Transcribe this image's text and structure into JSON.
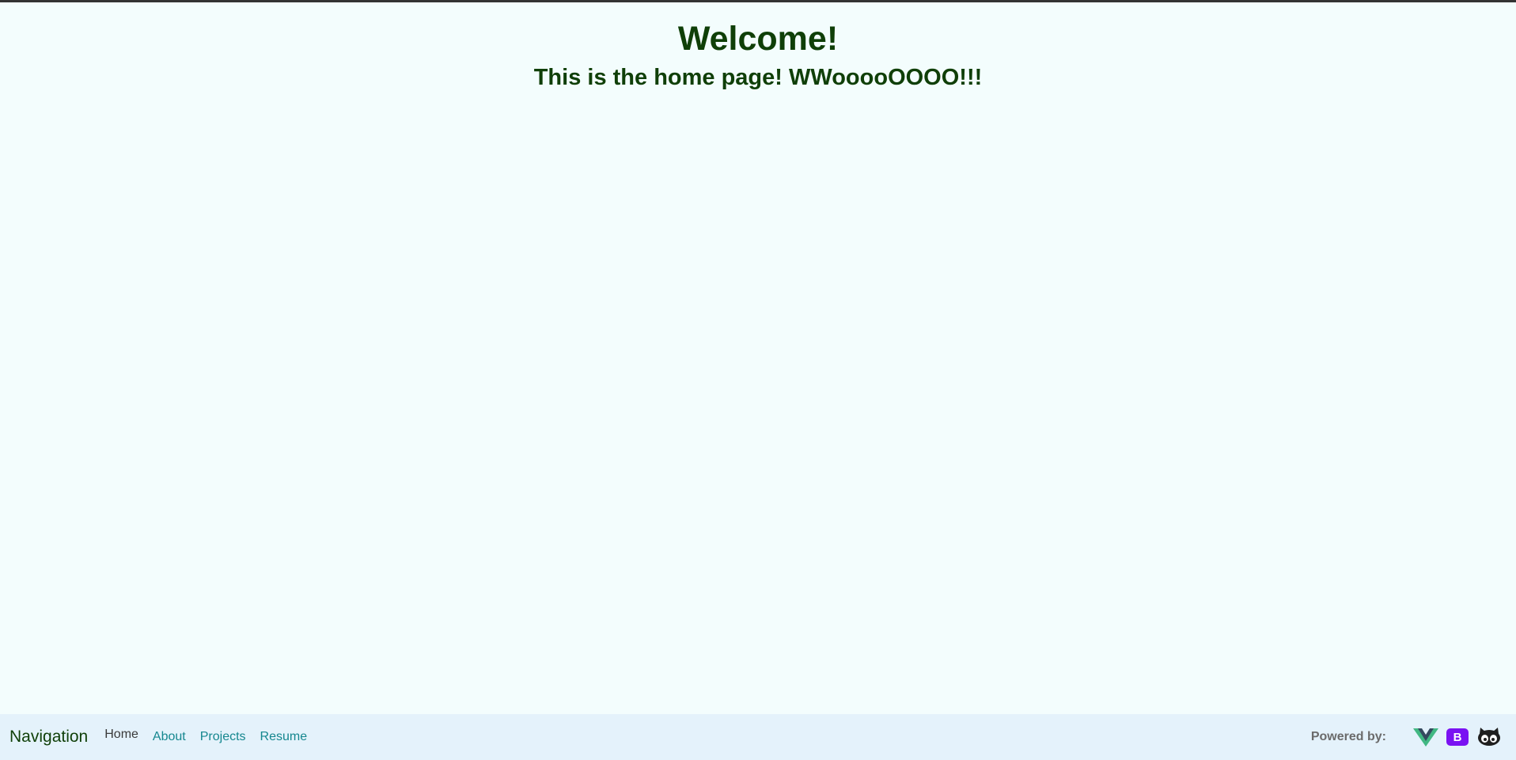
{
  "hero": {
    "title": "Welcome!",
    "subtitle": "This is the home page! WWooooOOOO!!!"
  },
  "nav": {
    "brand": "Navigation",
    "items": [
      {
        "label": "Home",
        "active": true
      },
      {
        "label": "About"
      },
      {
        "label": "Projects"
      },
      {
        "label": "Resume"
      }
    ],
    "powered_by": "Powered by:",
    "logos": {
      "bootstrap_letter": "B"
    }
  },
  "colors": {
    "background": "#f3fdfd",
    "navbar": "#e4f2fb",
    "heading": "#0f3f08",
    "link": "#15878f",
    "vue_green": "#41b883",
    "vue_dark": "#34495e",
    "bootstrap_purple": "#7a12f2"
  },
  "icons": [
    "vue-logo-icon",
    "bootstrap-logo-icon",
    "github-octocat-icon"
  ]
}
